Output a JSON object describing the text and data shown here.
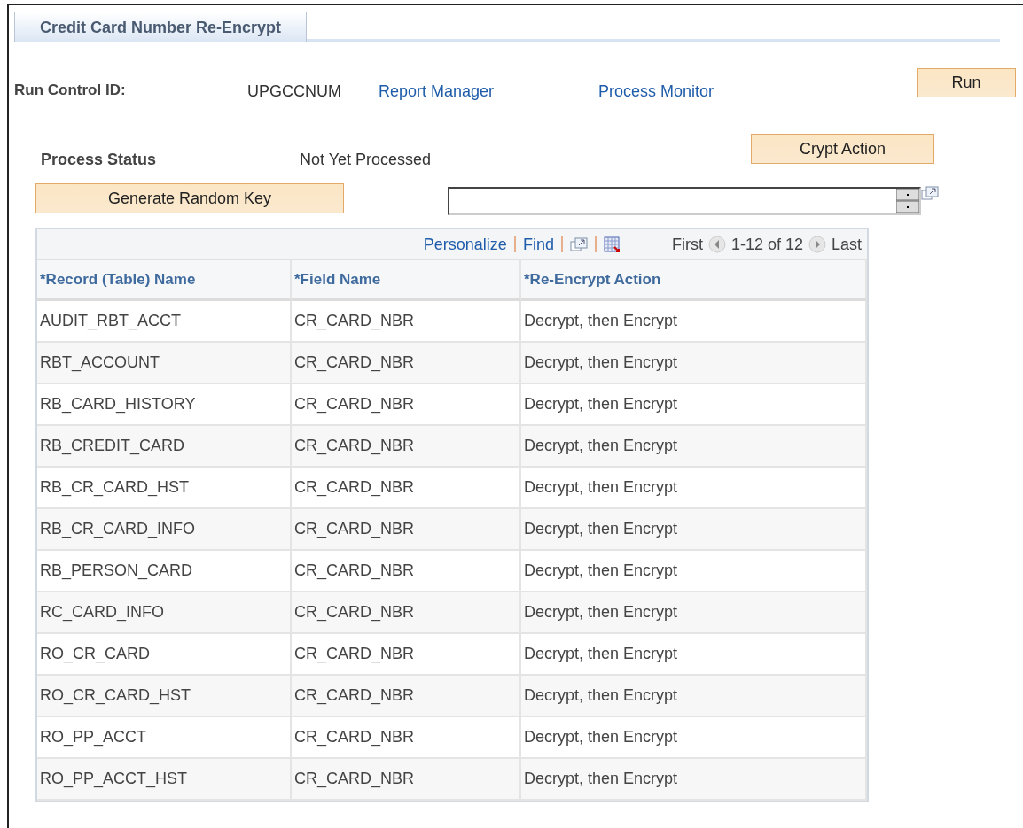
{
  "tabs": [
    {
      "label": "Credit Card Number Re-Encrypt",
      "selected": true
    }
  ],
  "run_control": {
    "label": "Run Control ID:",
    "value": "UPGCCNUM",
    "links": [
      "Report Manager",
      "Process Monitor"
    ],
    "button": "Run"
  },
  "process": {
    "label": "Process Status",
    "value": "Not Yet Processed",
    "button": "Crypt Action"
  },
  "generate_button": "Generate Random Key",
  "grid": {
    "toolbar": {
      "links": [
        "Personalize",
        "Find"
      ],
      "first": "First",
      "range": "1-12 of 12",
      "last": "Last"
    },
    "columns": [
      "*Record (Table) Name",
      "*Field Name",
      "*Re-Encrypt Action"
    ],
    "rows": [
      [
        "AUDIT_RBT_ACCT",
        "CR_CARD_NBR",
        "Decrypt, then Encrypt"
      ],
      [
        "RBT_ACCOUNT",
        "CR_CARD_NBR",
        "Decrypt, then Encrypt"
      ],
      [
        "RB_CARD_HISTORY",
        "CR_CARD_NBR",
        "Decrypt, then Encrypt"
      ],
      [
        "RB_CREDIT_CARD",
        "CR_CARD_NBR",
        "Decrypt, then Encrypt"
      ],
      [
        "RB_CR_CARD_HST",
        "CR_CARD_NBR",
        "Decrypt, then Encrypt"
      ],
      [
        "RB_CR_CARD_INFO",
        "CR_CARD_NBR",
        "Decrypt, then Encrypt"
      ],
      [
        "RB_PERSON_CARD",
        "CR_CARD_NBR",
        "Decrypt, then Encrypt"
      ],
      [
        "RC_CARD_INFO",
        "CR_CARD_NBR",
        "Decrypt, then Encrypt"
      ],
      [
        "RO_CR_CARD",
        "CR_CARD_NBR",
        "Decrypt, then Encrypt"
      ],
      [
        "RO_CR_CARD_HST",
        "CR_CARD_NBR",
        "Decrypt, then Encrypt"
      ],
      [
        "RO_PP_ACCT",
        "CR_CARD_NBR",
        "Decrypt, then Encrypt"
      ],
      [
        "RO_PP_ACCT_HST",
        "CR_CARD_NBR",
        "Decrypt, then Encrypt"
      ]
    ]
  }
}
